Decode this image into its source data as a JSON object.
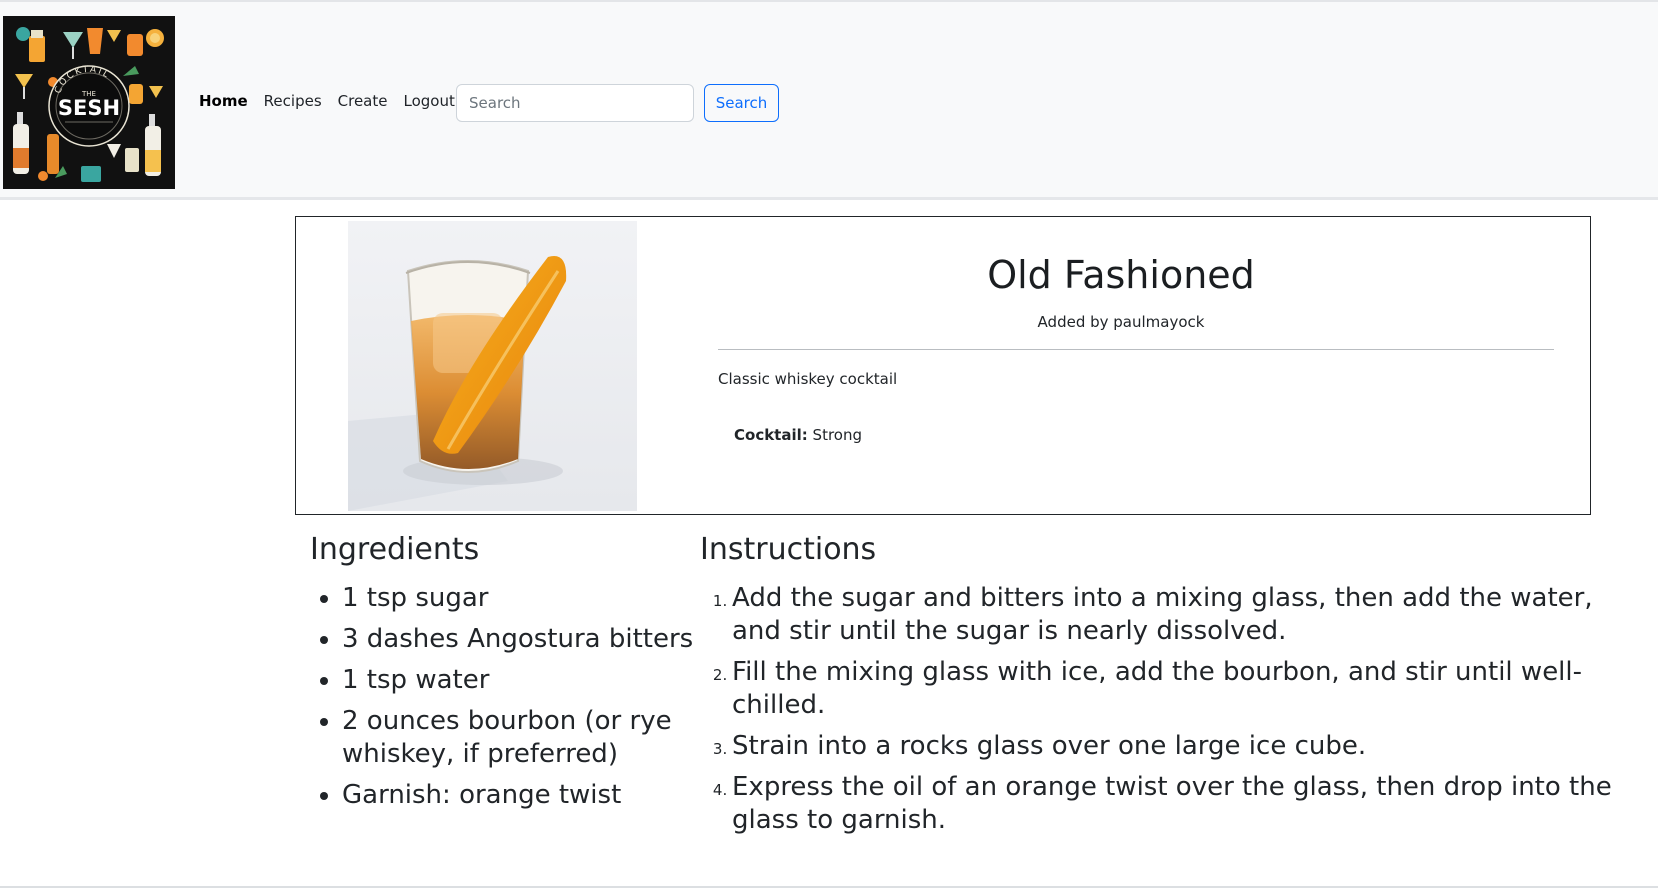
{
  "brand": {
    "logo_top": "COCKTAIL",
    "logo_the": "THE",
    "logo_main": "SESH",
    "background_color": "#111111"
  },
  "nav": {
    "items": [
      {
        "label": "Home",
        "active": true
      },
      {
        "label": "Recipes",
        "active": false
      },
      {
        "label": "Create",
        "active": false
      },
      {
        "label": "Logout",
        "active": false
      }
    ],
    "search_placeholder": "Search",
    "search_button_label": "Search",
    "accent_color": "#0d6efd"
  },
  "recipe": {
    "title": "Old Fashioned",
    "added_by": "Added by paulmayock",
    "description": "Classic whiskey cocktail",
    "category_label": "Cocktail:",
    "category_value": "Strong",
    "image_icon": "old-fashioned-glass-with-orange-twist"
  },
  "ingredients": {
    "heading": "Ingredients",
    "items": [
      "1 tsp sugar",
      "3 dashes Angostura bitters",
      "1 tsp water",
      "2 ounces bourbon (or rye whiskey, if preferred)",
      "Garnish: orange twist"
    ]
  },
  "instructions": {
    "heading": "Instructions",
    "steps": [
      "Add the sugar and bitters into a mixing glass, then add the water, and stir until the sugar is nearly dissolved.",
      "Fill the mixing glass with ice, add the bourbon, and stir until well-chilled.",
      "Strain into a rocks glass over one large ice cube.",
      "Express the oil of an orange twist over the glass, then drop into the glass to garnish."
    ]
  }
}
